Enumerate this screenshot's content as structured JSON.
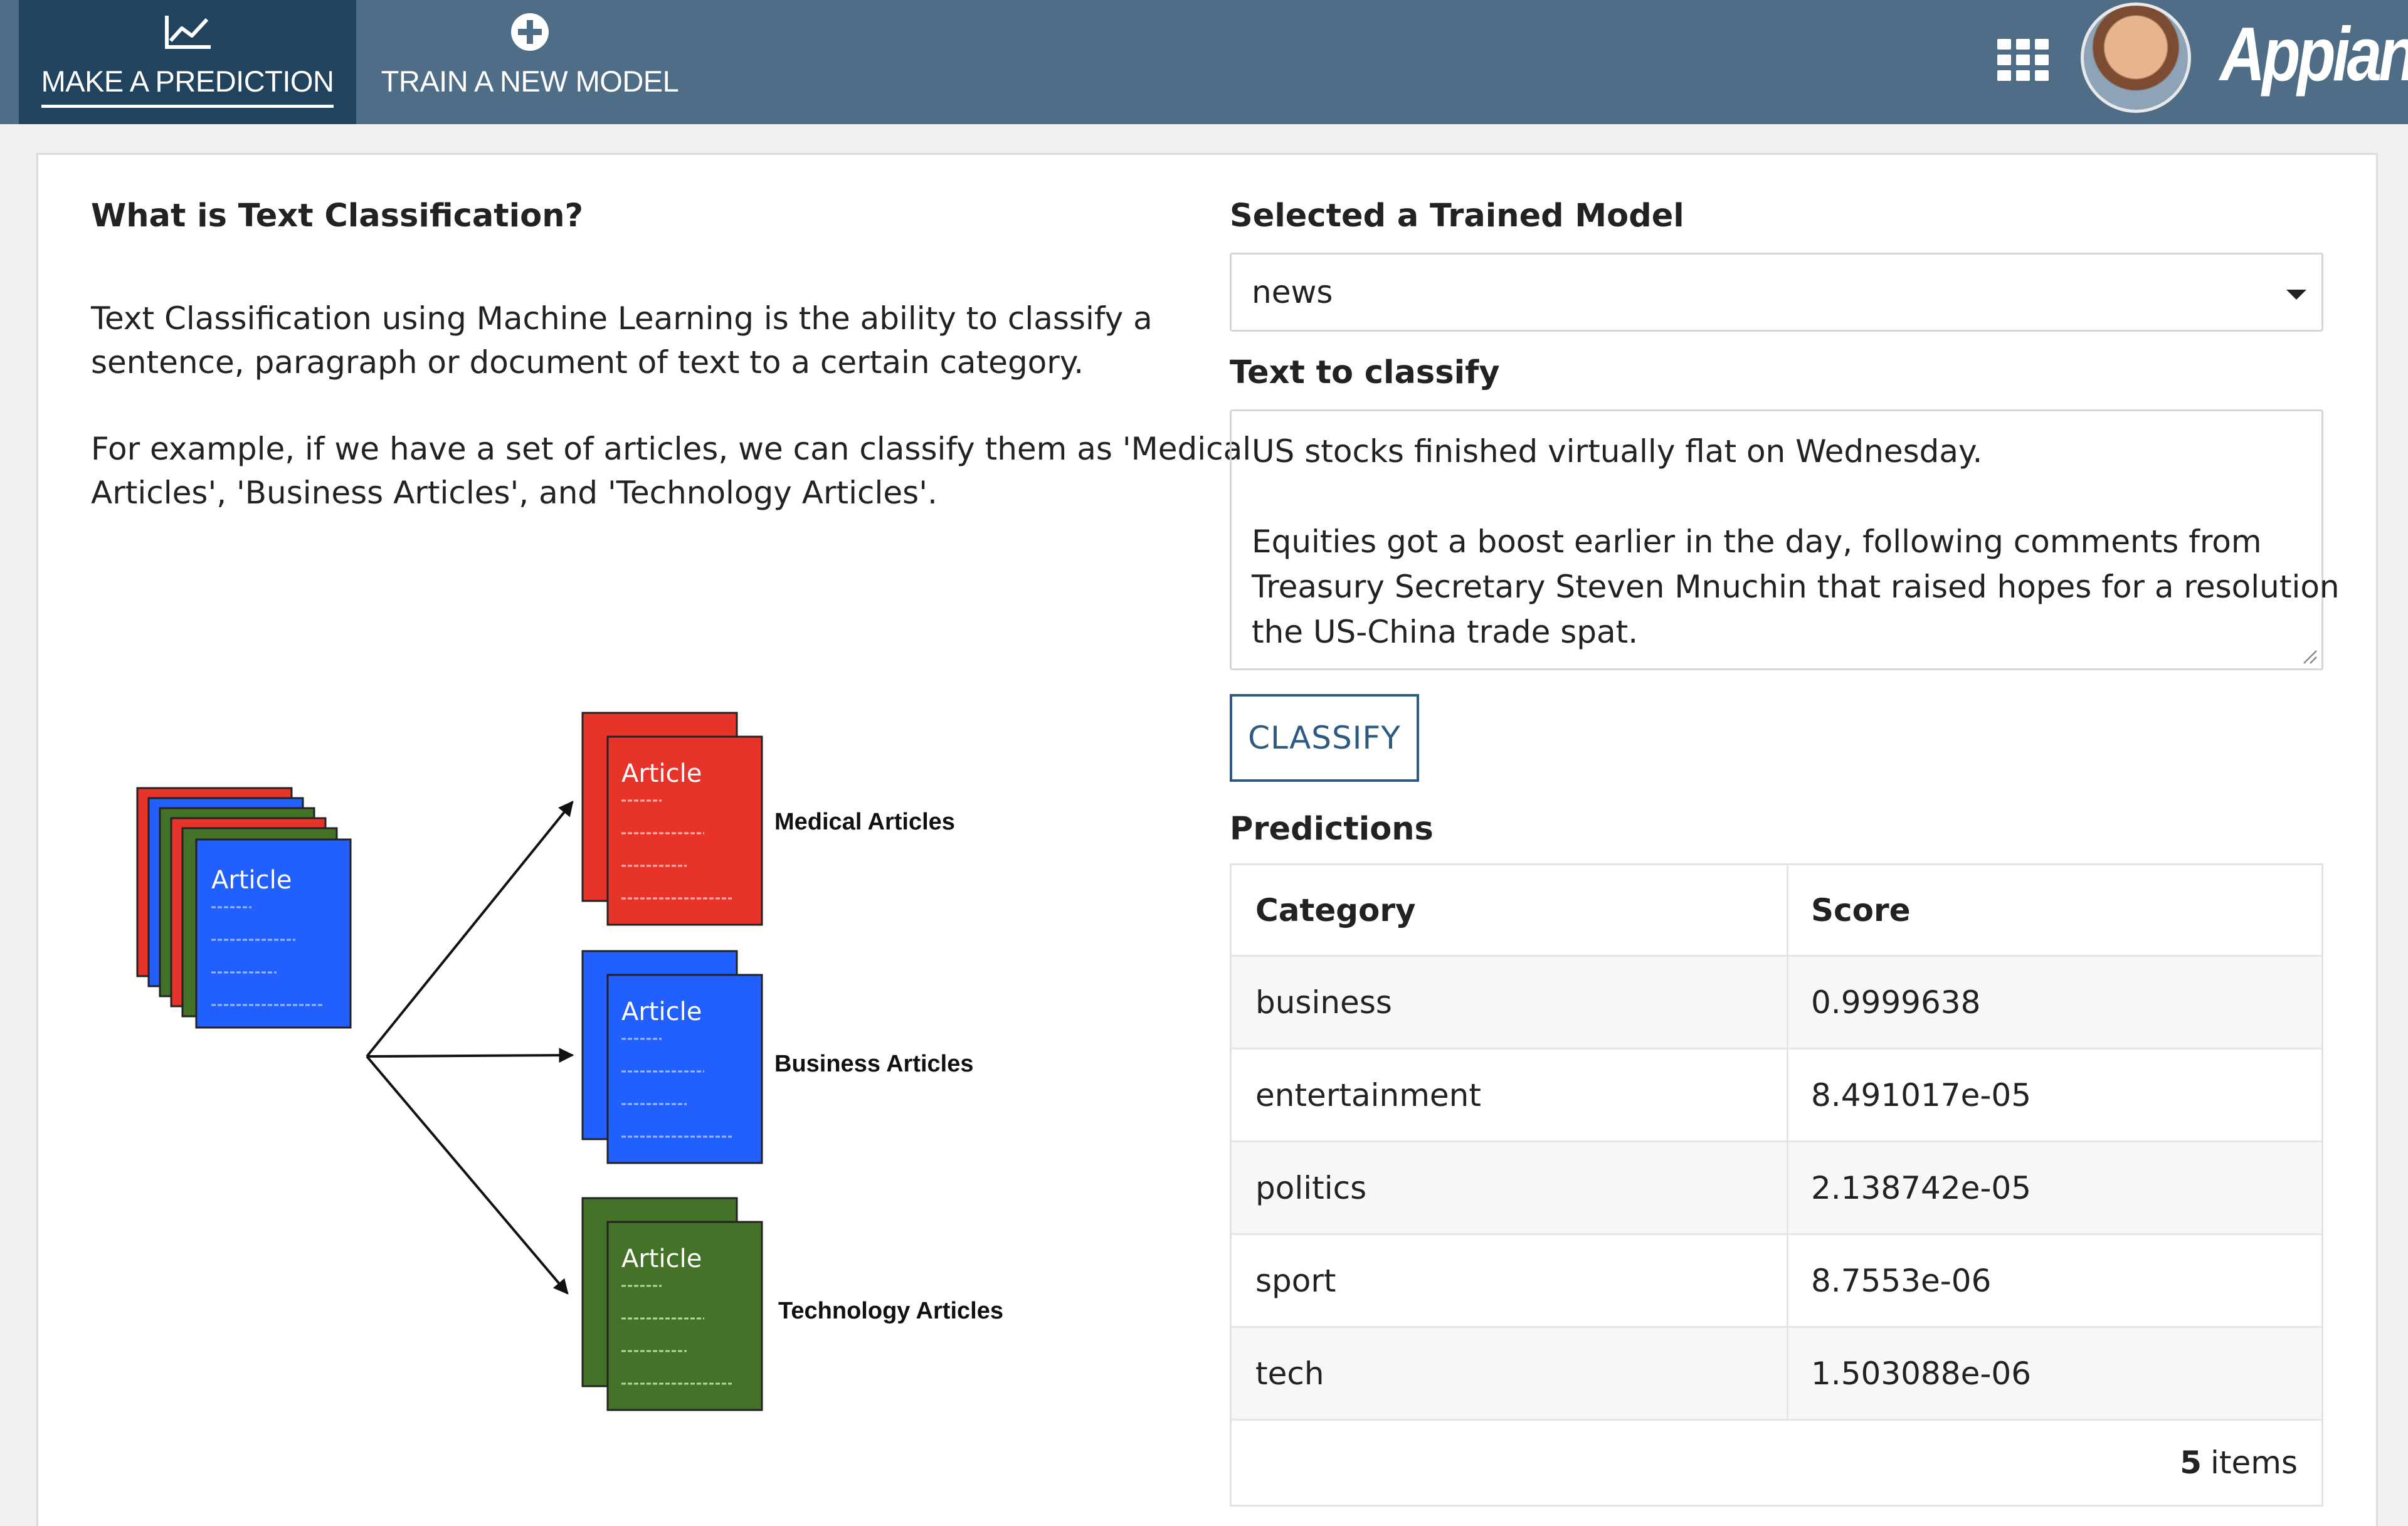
{
  "nav": {
    "tabs": [
      {
        "label": "MAKE A PREDICTION",
        "icon": "line-chart-icon",
        "active": true
      },
      {
        "label": "TRAIN A NEW MODEL",
        "icon": "plus-circle-icon",
        "active": false
      }
    ],
    "brand": "Appian",
    "apps_icon": "grid-icon",
    "avatar": "user-avatar"
  },
  "left": {
    "heading": "What is Text Classification?",
    "para1": [
      "Text Classification using Machine Learning is the ability to classify a",
      "sentence, paragraph or document of text to a certain category."
    ],
    "para2": [
      "For example, if we have a set of articles, we can classify them as 'Medical",
      "Articles', 'Business Articles', and 'Technology Articles'."
    ],
    "diagram": {
      "card_label": "Article",
      "categories": [
        {
          "label": "Medical Articles",
          "color": "#e8332a"
        },
        {
          "label": "Business Articles",
          "color": "#2160ff"
        },
        {
          "label": "Technology Articles",
          "color": "#457229"
        }
      ]
    }
  },
  "right": {
    "model_label": "Selected a Trained Model",
    "model_value": "news",
    "text_label": "Text to classify",
    "text_lines": [
      "US stocks finished virtually flat on Wednesday.",
      "",
      "Equities got a boost earlier in the day, following comments from",
      "Treasury Secretary Steven Mnuchin that raised hopes for a resolution",
      "the US-China trade spat."
    ],
    "classify_label": "CLASSIFY",
    "predictions_label": "Predictions",
    "table": {
      "headers": [
        "Category",
        "Score"
      ],
      "rows": [
        [
          "business",
          "0.9999638"
        ],
        [
          "entertainment",
          "8.491017e-05"
        ],
        [
          "politics",
          "2.138742e-05"
        ],
        [
          "sport",
          "8.7553e-06"
        ],
        [
          "tech",
          "1.503088e-06"
        ]
      ],
      "count": "5",
      "count_suffix": "items"
    }
  }
}
